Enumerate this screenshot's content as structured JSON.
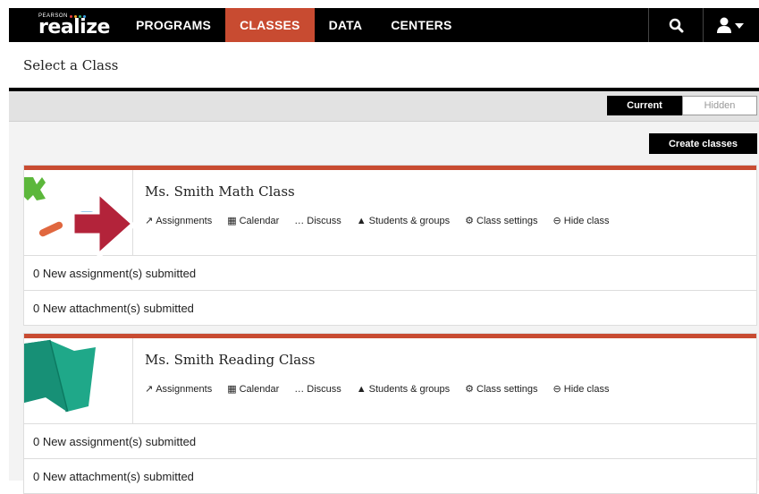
{
  "brand": {
    "pearson": "PEARSON",
    "name": "realize",
    "dot_colors": [
      "#e83e3e",
      "#f5a623",
      "#2bb673",
      "#3aa0e6"
    ]
  },
  "nav": {
    "items": [
      {
        "label": "PROGRAMS",
        "active": false
      },
      {
        "label": "CLASSES",
        "active": true
      },
      {
        "label": "DATA",
        "active": false
      },
      {
        "label": "CENTERS",
        "active": false
      }
    ],
    "search_icon": "search-icon",
    "user_icon": "user-menu-icon",
    "accent": "#c84b31"
  },
  "page": {
    "title": "Select a Class"
  },
  "filter": {
    "current_label": "Current",
    "hidden_label": "Hidden"
  },
  "create_label": "Create classes",
  "classes": [
    {
      "name": "Ms. Smith Math Class",
      "actions": {
        "assignments": "Assignments",
        "calendar": "Calendar",
        "discuss": "Discuss",
        "students": "Students & groups",
        "settings": "Class settings",
        "hide": "Hide class"
      },
      "rows": [
        "0 New assignment(s) submitted",
        "0 New attachment(s) submitted"
      ]
    },
    {
      "name": "Ms. Smith Reading Class",
      "actions": {
        "assignments": "Assignments",
        "calendar": "Calendar",
        "discuss": "Discuss",
        "students": "Students & groups",
        "settings": "Class settings",
        "hide": "Hide class"
      },
      "rows": [
        "0 New assignment(s) submitted",
        "0 New attachment(s) submitted"
      ]
    }
  ]
}
